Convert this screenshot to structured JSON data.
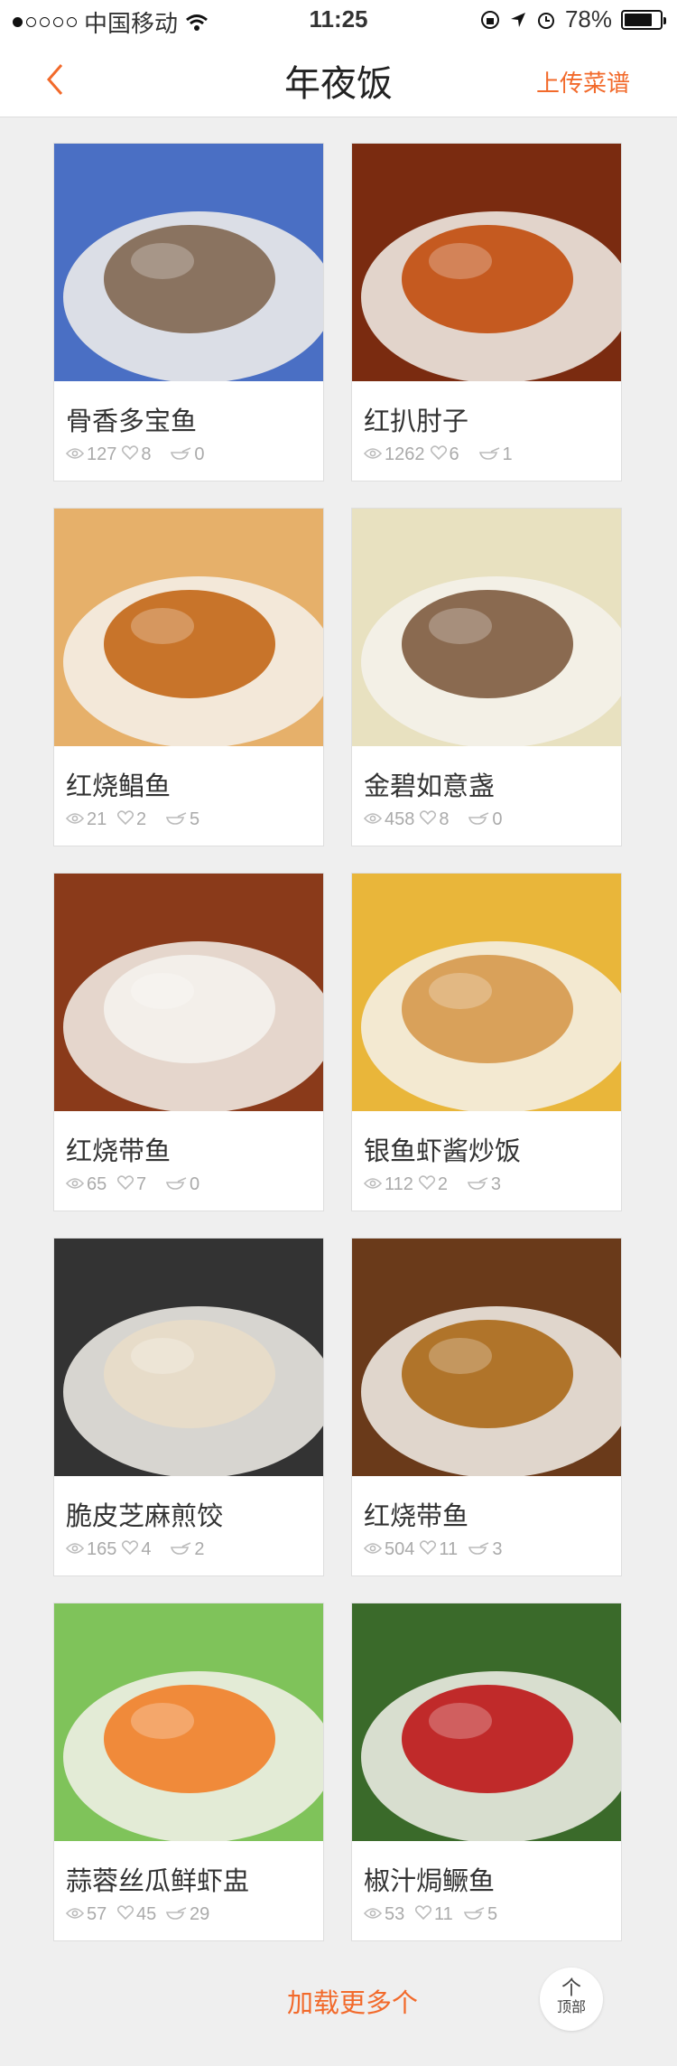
{
  "status_bar": {
    "carrier": "中国移动",
    "time": "11:25",
    "battery": "78%",
    "battery_level": 0.78
  },
  "nav": {
    "title": "年夜饭",
    "upload_label": "上传菜谱"
  },
  "recipes": [
    {
      "name": "骨香多宝鱼",
      "views": "127",
      "likes": "8",
      "comments": "0",
      "image": "fish-plate",
      "colors": [
        "#4a6fc4",
        "#8a7360"
      ]
    },
    {
      "name": "红扒肘子",
      "views": "1262",
      "likes": "6",
      "comments": "1",
      "image": "braised-pork",
      "colors": [
        "#7a2b10",
        "#c55a20"
      ]
    },
    {
      "name": "红烧鲳鱼",
      "views": "21",
      "likes": "2",
      "comments": "5",
      "image": "braised-pomfret",
      "colors": [
        "#e6b06a",
        "#c8742a"
      ]
    },
    {
      "name": "金碧如意盏",
      "views": "458",
      "likes": "8",
      "comments": "0",
      "image": "octopus-egg",
      "colors": [
        "#e8e1c0",
        "#8a6a50"
      ]
    },
    {
      "name": "红烧带鱼",
      "views": "65",
      "likes": "7",
      "comments": "0",
      "image": "hairtail",
      "colors": [
        "#8a3a1a",
        "#f3efea"
      ]
    },
    {
      "name": "银鱼虾酱炒饭",
      "views": "112",
      "likes": "2",
      "comments": "3",
      "image": "fried-rice",
      "colors": [
        "#e9b63a",
        "#d9a15a"
      ]
    },
    {
      "name": "脆皮芝麻煎饺",
      "views": "165",
      "likes": "4",
      "comments": "2",
      "image": "dumplings",
      "colors": [
        "#333333",
        "#e7dcc9"
      ]
    },
    {
      "name": "红烧带鱼",
      "views": "504",
      "likes": "11",
      "comments": "3",
      "image": "hairtail-2",
      "colors": [
        "#6a3a1a",
        "#b0742a"
      ]
    },
    {
      "name": "蒜蓉丝瓜鲜虾盅",
      "views": "57",
      "likes": "45",
      "comments": "29",
      "image": "shrimp-loofah",
      "colors": [
        "#7fc35a",
        "#f08a3a"
      ]
    },
    {
      "name": "椒汁焗鳜鱼",
      "views": "53",
      "likes": "11",
      "comments": "5",
      "image": "mandarin-fish",
      "colors": [
        "#3a6a2a",
        "#c02a2a"
      ]
    }
  ],
  "load_more_label": "加载更多个",
  "to_top": {
    "arrow": "个",
    "label": "顶部"
  }
}
